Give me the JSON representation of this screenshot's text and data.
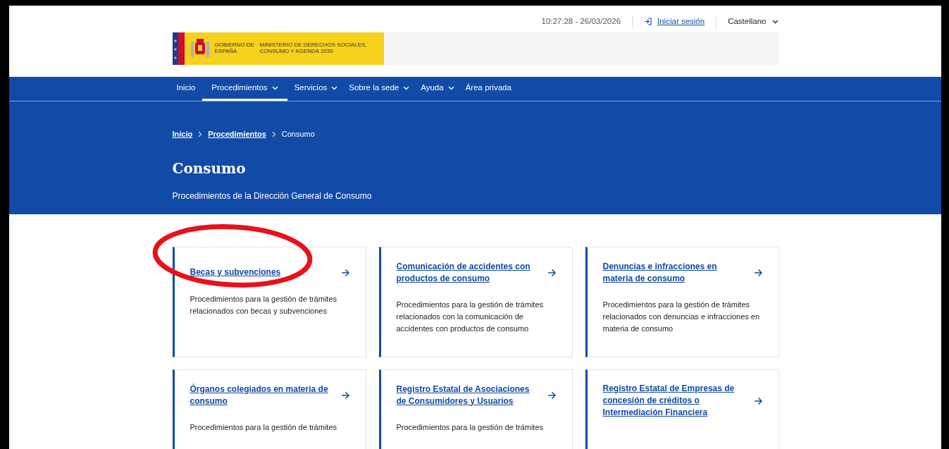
{
  "header": {
    "time": "10:27:28 - 26/03/2026",
    "login": {
      "label": "Iniciar sesión"
    },
    "language": {
      "label": "Castellano"
    }
  },
  "logo": {
    "government": "GOBIERNO DE ESPAÑA",
    "ministry": "MINISTERIO DE DERECHOS SOCIALES, CONSUMO Y AGENDA 2030"
  },
  "nav": [
    {
      "label": "Inicio",
      "dropdown": false,
      "selected": false
    },
    {
      "label": "Procedimientos",
      "dropdown": true,
      "selected": true
    },
    {
      "label": "Servicios",
      "dropdown": true,
      "selected": false
    },
    {
      "label": "Sobre la sede",
      "dropdown": true,
      "selected": false
    },
    {
      "label": "Ayuda",
      "dropdown": true,
      "selected": false
    },
    {
      "label": "Área privada",
      "dropdown": false,
      "selected": false
    }
  ],
  "breadcrumb": [
    {
      "label": "Inicio",
      "link": true
    },
    {
      "label": "Procedimientos",
      "link": true
    },
    {
      "label": "Consumo",
      "link": false
    }
  ],
  "page_title": "Consumo",
  "subtitle": "Procedimientos de la Dirección General de Consumo",
  "cards": [
    {
      "title": "Becas y subvenciones",
      "description": "Procedimientos para la gestión de trámites relacionados con becas y subvenciones",
      "circled": true
    },
    {
      "title": "Comunicación de accidentes con productos de consumo",
      "description": "Procedimientos para la gestión de trámites relacionados con la comunicación de accidentes con productos de consumo",
      "circled": false
    },
    {
      "title": "Denuncias e infracciones en materia de consumo",
      "description": "Procedimientos para la gestión de trámites relacionados con denuncias e infracciones en materia de consumo",
      "circled": false
    },
    {
      "title": "Órganos colegiados en materia de consumo",
      "description": "Procedimientos para la gestión de trámites",
      "circled": false
    },
    {
      "title": "Registro Estatal de Asociaciones de Consumidores y Usuarios",
      "description": "Procedimientos para la gestión de trámites",
      "circled": false
    },
    {
      "title": "Registro Estatal de Empresas de concesión de créditos o Intermediación Financiera",
      "circled": false
    }
  ]
}
